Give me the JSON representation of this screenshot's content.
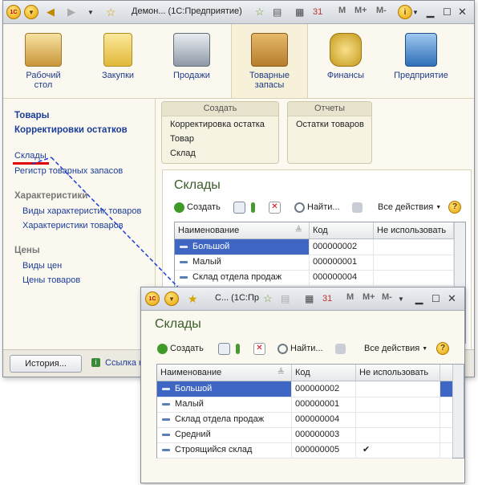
{
  "main_window": {
    "title": "Демон... (1С:Предприятие)",
    "m_buttons": [
      "M",
      "M+",
      "M-"
    ],
    "sections": [
      {
        "label": "Рабочий стол",
        "icon": "desk-icon"
      },
      {
        "label": "Закупки",
        "icon": "shopping-bag-icon"
      },
      {
        "label": "Продажи",
        "icon": "cash-register-icon"
      },
      {
        "label": "Товарные запасы",
        "icon": "box-icon",
        "active": true
      },
      {
        "label": "Финансы",
        "icon": "coins-icon"
      },
      {
        "label": "Предприятие",
        "icon": "building-icon"
      }
    ],
    "nav": {
      "bold_items": [
        "Товары",
        "Корректировки остатков"
      ],
      "items_group1": [
        "Склады",
        "Регистр товарных запасов"
      ],
      "header2": "Характеристики",
      "items_group2": [
        "Виды характеристик товаров",
        "Характеристики товаров"
      ],
      "header3": "Цены",
      "items_group3": [
        "Виды цен",
        "Цены товаров"
      ]
    },
    "groups": [
      {
        "title": "Создать",
        "items": [
          "Корректировка остатка",
          "Товар",
          "Склад"
        ]
      },
      {
        "title": "Отчеты",
        "items": [
          "Остатки товаров"
        ]
      }
    ],
    "form": {
      "title": "Склады",
      "create": "Создать",
      "find": "Найти...",
      "all_actions": "Все действия",
      "help": "?",
      "columns": [
        "Наименование",
        "Код",
        "Не использовать"
      ],
      "rows": [
        {
          "name": "Большой",
          "code": "000000002",
          "unused": "",
          "selected": true
        },
        {
          "name": "Малый",
          "code": "000000001",
          "unused": ""
        },
        {
          "name": "Склад отдела продаж",
          "code": "000000004",
          "unused": ""
        }
      ]
    },
    "bottom": {
      "history": "История...",
      "link": "Ссылка н"
    }
  },
  "popup_window": {
    "title": "С...  (1С:Пр",
    "m_buttons": [
      "M",
      "M+",
      "M-"
    ],
    "form": {
      "title": "Склады",
      "create": "Создать",
      "find": "Найти...",
      "all_actions": "Все действия",
      "help": "?",
      "columns": [
        "Наименование",
        "Код",
        "Не использовать"
      ],
      "rows": [
        {
          "name": "Большой",
          "code": "000000002",
          "unused": "",
          "selected": true
        },
        {
          "name": "Малый",
          "code": "000000001",
          "unused": ""
        },
        {
          "name": "Склад отдела продаж",
          "code": "000000004",
          "unused": ""
        },
        {
          "name": "Средний",
          "code": "000000003",
          "unused": ""
        },
        {
          "name": "Строящийся склад",
          "code": "000000005",
          "unused": "✔"
        }
      ]
    }
  },
  "colors": {
    "selection": "#3e66c2",
    "link": "#1a3c9a",
    "form_title": "#3a5d2a",
    "underline": "#e00000",
    "arrow": "#1f3fd6"
  }
}
